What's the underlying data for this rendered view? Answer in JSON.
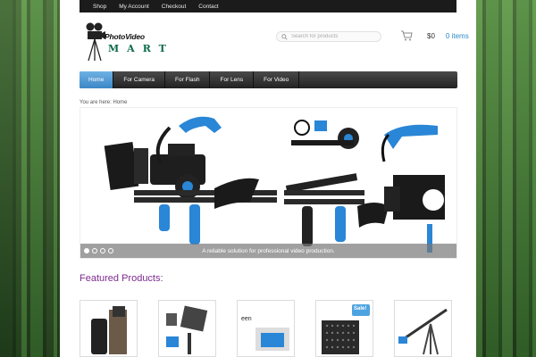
{
  "topbar": {
    "links": [
      "Shop",
      "My Account",
      "Checkout",
      "Contact"
    ]
  },
  "logo": {
    "title": "PhotoVideo",
    "subtitle": "MART"
  },
  "search": {
    "placeholder": "Search for products"
  },
  "cart": {
    "amount": "$0",
    "items": "0 items"
  },
  "nav": {
    "items": [
      "Home",
      "For Camera",
      "For Flash",
      "For Lens",
      "For Video"
    ],
    "active": "Home"
  },
  "breadcrumb": "You are here: Home",
  "slider": {
    "caption": "A reliable solution for professional video production.",
    "dots": 4,
    "active_dot": 1
  },
  "featured": {
    "heading": "Featured Products:",
    "products": [
      {
        "icon": "flash-product"
      },
      {
        "icon": "led-panel-product",
        "label": ""
      },
      {
        "icon": "monitor-product",
        "label": "een"
      },
      {
        "icon": "led-light-product",
        "badge": "Sale!"
      },
      {
        "icon": "jib-crane-product"
      }
    ]
  },
  "colors": {
    "accent": "#3b87c7",
    "heading": "#7d2a8f",
    "link": "#2e8ac9",
    "rig_blue": "#2a86d6"
  }
}
